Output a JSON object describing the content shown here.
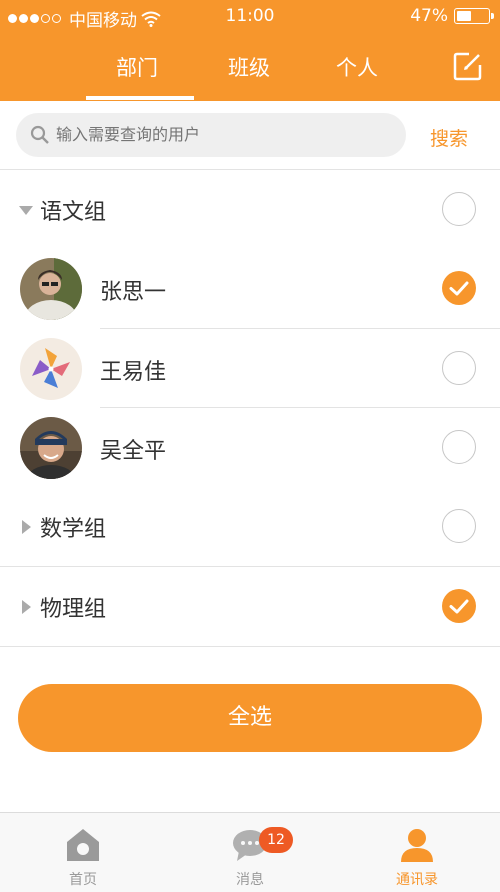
{
  "status_bar": {
    "carrier": "中国移动",
    "time": "11:00",
    "battery": "47%",
    "battery_level": 0.47
  },
  "tabs": [
    {
      "label": "部门",
      "active": true
    },
    {
      "label": "班级",
      "active": false
    },
    {
      "label": "个人",
      "active": false
    }
  ],
  "search": {
    "placeholder": "输入需要查询的用户",
    "button_label": "搜索"
  },
  "groups": [
    {
      "name": "语文组",
      "expanded": true,
      "checked": false,
      "members": [
        {
          "name": "张思一",
          "checked": true
        },
        {
          "name": "王易佳",
          "checked": false
        },
        {
          "name": "吴全平",
          "checked": false
        }
      ]
    },
    {
      "name": "数学组",
      "expanded": false,
      "checked": false
    },
    {
      "name": "物理组",
      "expanded": false,
      "checked": true
    }
  ],
  "select_all_label": "全选",
  "bottom_nav": [
    {
      "label": "首页",
      "icon": "home-icon",
      "active": false
    },
    {
      "label": "消息",
      "icon": "chat-bubble-icon",
      "active": false,
      "badge": "12"
    },
    {
      "label": "通讯录",
      "icon": "person-icon",
      "active": true
    }
  ],
  "colors": {
    "accent": "#f7962c",
    "badge": "#ee5a24",
    "inactive": "#9a9a9a"
  }
}
